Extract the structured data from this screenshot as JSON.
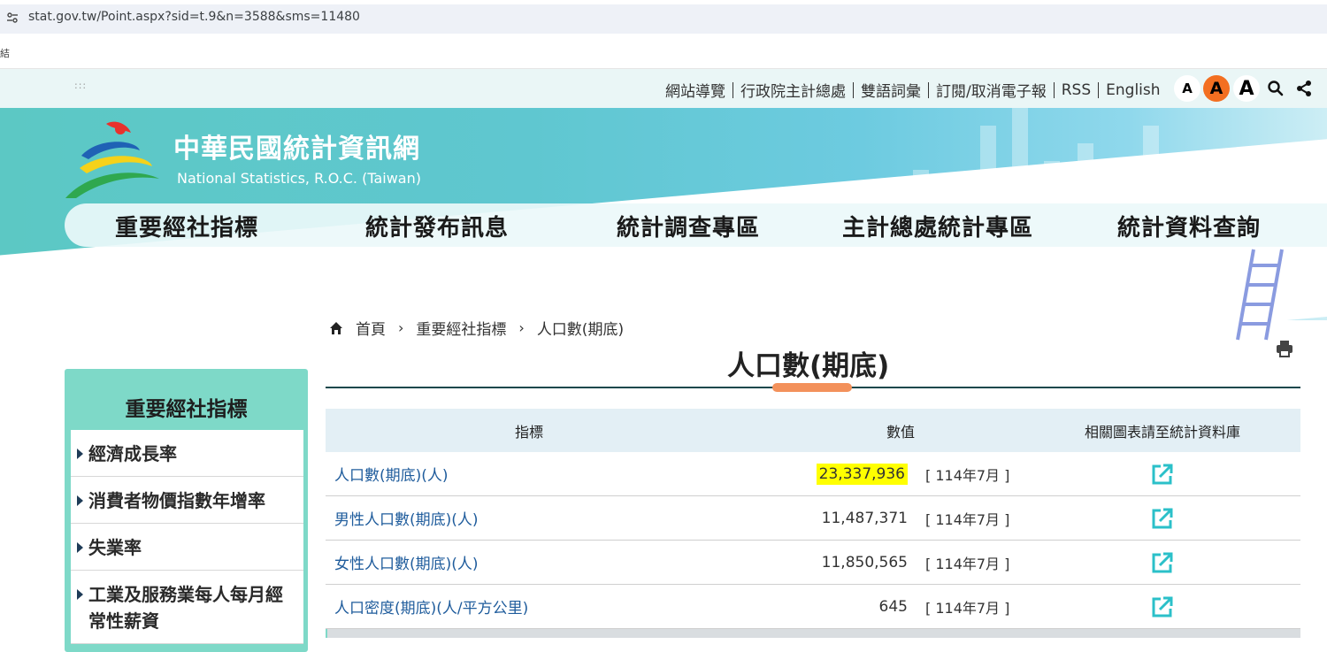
{
  "browser": {
    "url": "stat.gov.tw/Point.aspx?sid=t.9&n=3588&sms=11480"
  },
  "bookmark_bar": {
    "item": "結"
  },
  "utility": {
    "dots": ":::",
    "links": [
      "網站導覽",
      "行政院主計總處",
      "雙語詞彙",
      "訂閱/取消電子報",
      "RSS",
      "English"
    ],
    "font_sizes": [
      "A",
      "A",
      "A"
    ],
    "active_font_index": 1
  },
  "site": {
    "title": "中華民國統計資訊網",
    "subtitle": "National Statistics, R.O.C. (Taiwan)"
  },
  "main_nav": [
    "重要經社指標",
    "統計發布訊息",
    "統計調查專區",
    "主計總處統計專區",
    "統計資料查詢"
  ],
  "breadcrumb": {
    "home": "首頁",
    "section": "重要經社指標",
    "current": "人口數(期底)"
  },
  "page_title": "人口數(期底)",
  "sidebar": {
    "title": "重要經社指標",
    "items": [
      "經濟成長率",
      "消費者物價指數年增率",
      "失業率",
      "工業及服務業每人每月經常性薪資"
    ]
  },
  "table": {
    "headers": {
      "indicator": "指標",
      "value": "數值",
      "link": "相關圖表請至統計資料庫"
    },
    "rows": [
      {
        "name": "人口數(期底)(人)",
        "value": "23,337,936",
        "period": "[ 114年7月 ]"
      },
      {
        "name": "男性人口數(期底)(人)",
        "value": "11,487,371",
        "period": "[ 114年7月 ]"
      },
      {
        "name": "女性人口數(期底)(人)",
        "value": "11,850,565",
        "period": "[ 114年7月 ]"
      },
      {
        "name": "人口密度(期底)(人/平方公里)",
        "value": "645",
        "period": "[ 114年7月 ]"
      }
    ]
  },
  "colors": {
    "accent": "#f36f21",
    "teal": "#5cc8c4",
    "sidebar": "#7ed9c8",
    "highlight": "#ffff00",
    "link": "#1f5c9c"
  }
}
